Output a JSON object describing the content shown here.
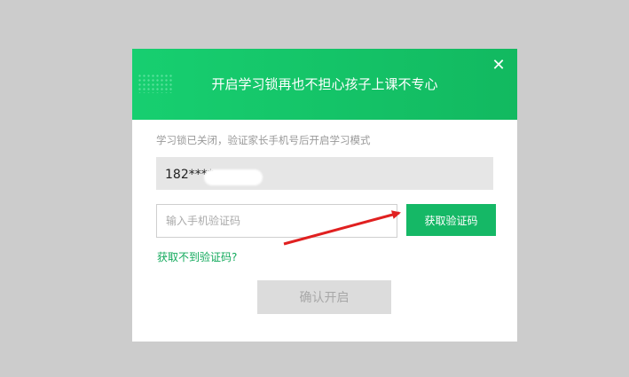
{
  "dialog": {
    "title": "开启学习锁再也不担心孩子上课不专心",
    "close_icon": "close-icon",
    "hint": "学习锁已关闭，验证家长手机号后开启学习模式",
    "phone_value": "182****",
    "code_input": {
      "placeholder": "输入手机验证码",
      "value": ""
    },
    "get_code_label": "获取验证码",
    "no_code_link": "获取不到验证码?",
    "confirm_label": "确认开启",
    "colors": {
      "accent": "#15b866",
      "link": "#11a95b",
      "disabled_bg": "#dcdcdc",
      "arrow": "#e02020"
    }
  }
}
